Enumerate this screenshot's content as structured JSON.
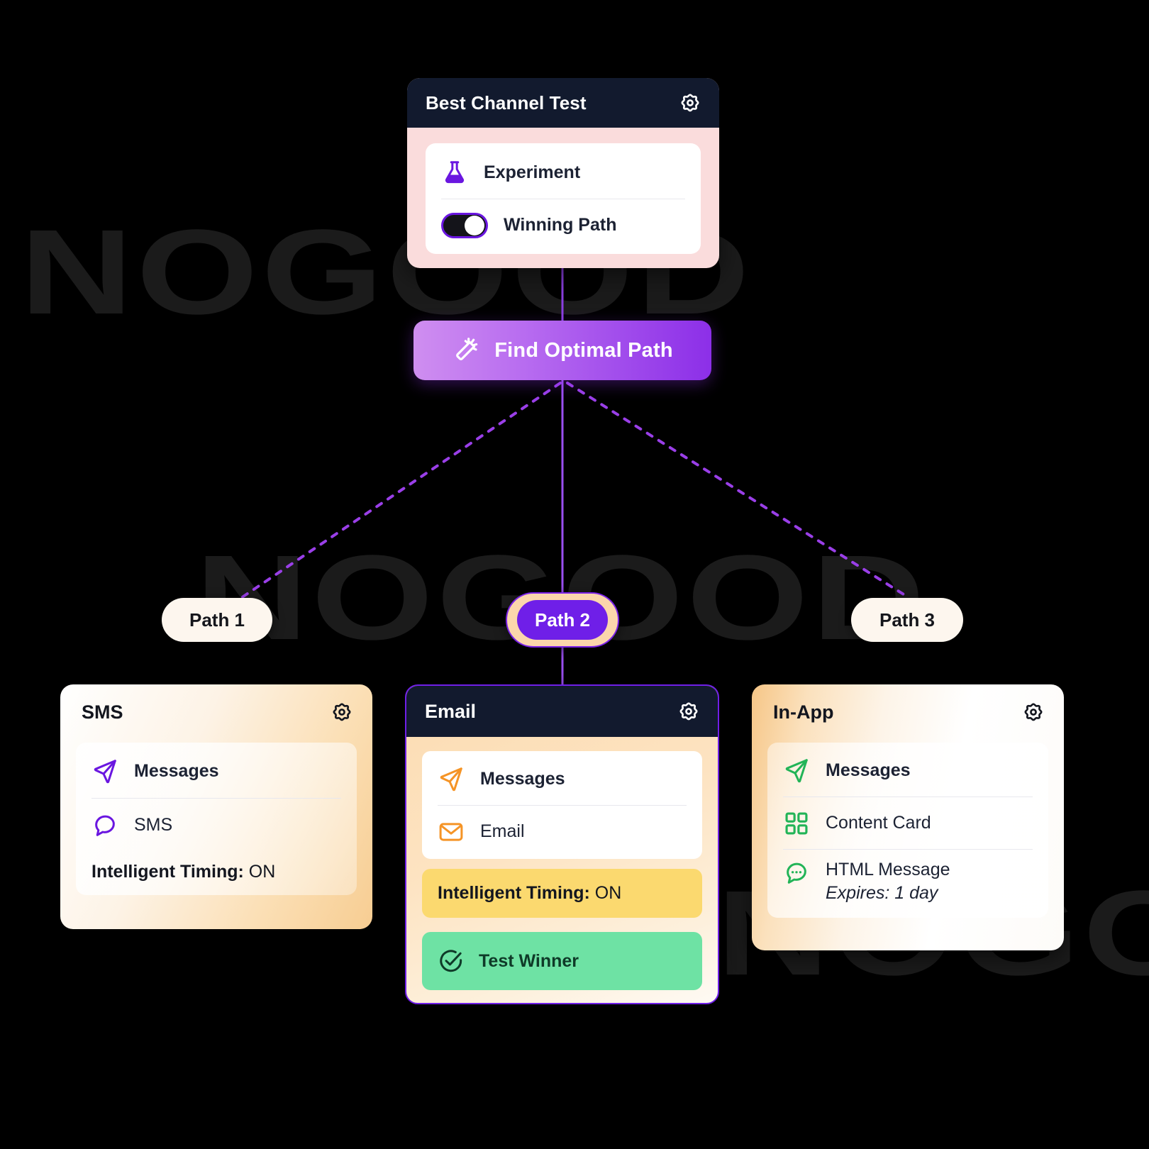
{
  "watermarks": {
    "text": "NOGOOD",
    "count": 3
  },
  "test_card": {
    "title": "Best Channel Test",
    "gear_icon": "gear-icon",
    "rows": [
      {
        "icon": "flask-icon",
        "label": "Experiment"
      },
      {
        "icon": "toggle-switch",
        "label": "Winning Path"
      }
    ]
  },
  "optimal_button": {
    "label": "Find Optimal Path",
    "icon": "magic-wand-icon",
    "accent_from": "#cf8ef0",
    "accent_to": "#8c2fe8"
  },
  "paths": [
    {
      "label": "Path 1",
      "selected": false
    },
    {
      "label": "Path 2",
      "selected": true
    },
    {
      "label": "Path 3",
      "selected": false
    }
  ],
  "sms_card": {
    "title": "SMS",
    "gear_icon": "gear-icon",
    "rows": [
      {
        "icon": "send-icon",
        "label": "Messages"
      },
      {
        "icon": "chat-bubble-icon",
        "label": "SMS"
      }
    ],
    "timing_label": "Intelligent Timing:",
    "timing_value": "ON",
    "accent": "#6a16e0"
  },
  "email_card": {
    "title": "Email",
    "gear_icon": "gear-icon",
    "rows": [
      {
        "icon": "send-icon",
        "label": "Messages"
      },
      {
        "icon": "envelope-icon",
        "label": "Email"
      }
    ],
    "timing_label": "Intelligent Timing:",
    "timing_value": "ON",
    "winner_label": "Test Winner",
    "winner_icon": "check-circle-icon",
    "accent": "#f59426",
    "border": "#6f1fe8"
  },
  "inapp_card": {
    "title": "In-App",
    "gear_icon": "gear-icon",
    "rows": [
      {
        "icon": "send-icon",
        "label": "Messages"
      },
      {
        "icon": "grid-icon",
        "label": "Content Card"
      }
    ],
    "html_message_label": "HTML Message",
    "html_message_icon": "chat-dots-icon",
    "expires_label": "Expires: 1 day",
    "accent": "#22b457"
  }
}
